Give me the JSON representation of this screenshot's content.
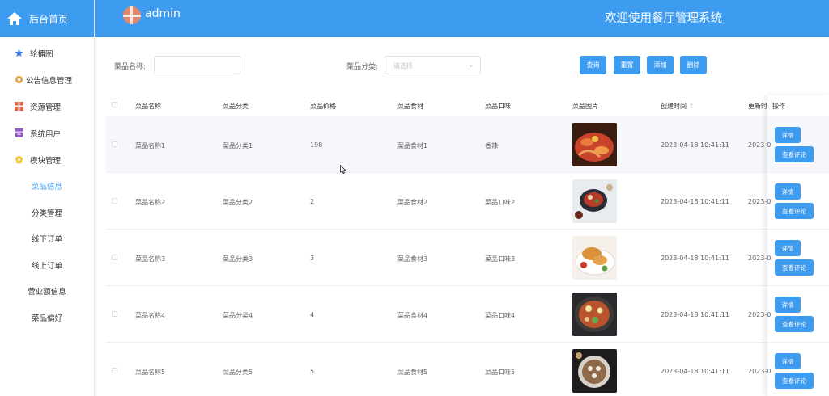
{
  "sidebar": {
    "home_label": "后台首页",
    "items": [
      {
        "label": "轮播图",
        "icon": "star-icon",
        "color": "#3d7ee8"
      },
      {
        "label": "公告信息管理",
        "icon": "bell-icon",
        "color": "#e8a03d"
      },
      {
        "label": "资源管理",
        "icon": "grid-icon",
        "color": "#e8624a"
      },
      {
        "label": "系统用户",
        "icon": "box-icon",
        "color": "#8e5bbf"
      },
      {
        "label": "模块管理",
        "icon": "gem-icon",
        "color": "#f0c419"
      }
    ],
    "sub_items": [
      {
        "label": "菜品信息",
        "active": true
      },
      {
        "label": "分类管理"
      },
      {
        "label": "线下订单"
      },
      {
        "label": "线上订单"
      },
      {
        "label": "营业额信息"
      },
      {
        "label": "菜品偏好"
      }
    ]
  },
  "header": {
    "user": "admin",
    "title": "欢迎使用餐厅管理系统"
  },
  "search": {
    "name_label": "菜品名称:",
    "name_value": "",
    "category_label": "菜品分类:",
    "category_placeholder": "请选择",
    "buttons": [
      "查询",
      "重置",
      "添加",
      "删除"
    ]
  },
  "table": {
    "columns": [
      "菜品名称",
      "菜品分类",
      "菜品价格",
      "菜品食材",
      "菜品口味",
      "菜品图片",
      "创建时间",
      "更新时",
      "操作"
    ],
    "sort_indicator": "⇕",
    "rows": [
      {
        "name": "菜品名称1",
        "category": "菜品分类1",
        "price": "198",
        "ingredients": "菜品食材1",
        "taste": "香辣",
        "created": "2023-04-18 10:41:11",
        "updated": "2023-0"
      },
      {
        "name": "菜品名称2",
        "category": "菜品分类2",
        "price": "2",
        "ingredients": "菜品食材2",
        "taste": "菜品口味2",
        "created": "2023-04-18 10:41:11",
        "updated": "2023-0"
      },
      {
        "name": "菜品名称3",
        "category": "菜品分类3",
        "price": "3",
        "ingredients": "菜品食材3",
        "taste": "菜品口味3",
        "created": "2023-04-18 10:41:11",
        "updated": "2023-0"
      },
      {
        "name": "菜品名称4",
        "category": "菜品分类4",
        "price": "4",
        "ingredients": "菜品食材4",
        "taste": "菜品口味4",
        "created": "2023-04-18 10:41:11",
        "updated": "2023-0"
      },
      {
        "name": "菜品名称5",
        "category": "菜品分类5",
        "price": "5",
        "ingredients": "菜品食材5",
        "taste": "菜品口味5",
        "created": "2023-04-18 10:41:11",
        "updated": "2023-0"
      }
    ],
    "actions": [
      "详情",
      "查看评论"
    ]
  },
  "colors": {
    "primary": "#3d9cf0",
    "row_highlight": "#f5f7fa"
  }
}
